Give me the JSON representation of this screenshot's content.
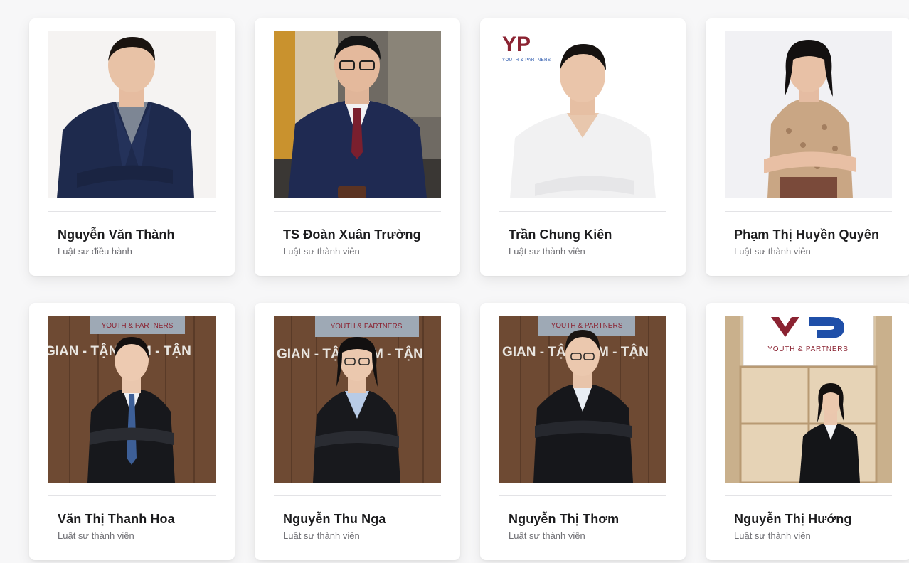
{
  "team": {
    "members": [
      {
        "name": "Nguyễn Văn Thành",
        "role": "Luật sư điều hành"
      },
      {
        "name": "TS Đoàn Xuân Trường",
        "role": "Luật sư thành viên"
      },
      {
        "name": "Trần Chung Kiên",
        "role": "Luật sư thành viên"
      },
      {
        "name": "Phạm Thị Huyền Quyên",
        "role": "Luật sư thành viên"
      },
      {
        "name": "Văn Thị Thanh Hoa",
        "role": "Luật sư thành viên"
      },
      {
        "name": "Nguyễn Thu Nga",
        "role": "Luật sư thành viên"
      },
      {
        "name": "Nguyễn Thị Thơm",
        "role": "Luật sư thành viên"
      },
      {
        "name": "Nguyễn Thị Hướng",
        "role": "Luật sư thành viên"
      }
    ]
  },
  "logo": {
    "letters": "YP",
    "text": "YOUTH & PARTNERS"
  },
  "wall_sign": {
    "text": "GIAN - TẬN TÂM - TẬN"
  },
  "colors": {
    "page_bg": "#f7f7f8",
    "card_bg": "#ffffff",
    "name": "#1c1c1e",
    "role": "#6e6e73",
    "logo_red": "#8b2332",
    "logo_blue": "#1f4fa8",
    "wood": "#6e4a33"
  }
}
